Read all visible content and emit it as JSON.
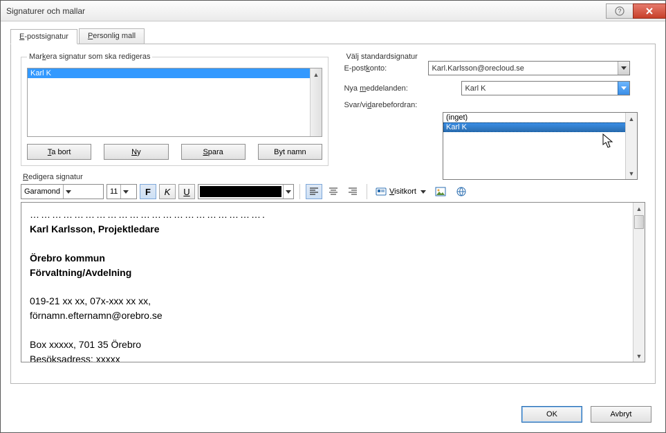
{
  "titlebar": {
    "title": "Signaturer och mallar"
  },
  "tabs": {
    "email": "E-postsignatur",
    "personal": "Personlig mall"
  },
  "select_legend_pre": "Mar",
  "select_legend_u": "k",
  "select_legend_post": "era signatur som ska redigeras",
  "signature_list": {
    "item0": "Karl K"
  },
  "buttons": {
    "delete_pre": "",
    "delete_u": "T",
    "delete_post": "a bort",
    "new_pre": "",
    "new_u": "N",
    "new_post": "y",
    "save_pre": "",
    "save_u": "S",
    "save_post": "para",
    "rename": "Byt namn"
  },
  "default_legend": "Välj standardsignatur",
  "account_label": "E-postkonto:",
  "account_value": "Karl.Karlsson@orecloud.se",
  "newmsg_label_pre": "Nya ",
  "newmsg_label_u": "m",
  "newmsg_label_post": "eddelanden:",
  "newmsg_value": "Karl K",
  "reply_label_pre": "Svar/vi",
  "reply_label_u": "d",
  "reply_label_post": "arebefordran:",
  "reply_options": {
    "none": "(inget)",
    "karl": "Karl K"
  },
  "editor_legend_pre": "",
  "editor_legend_u": "R",
  "editor_legend_post": "edigera signatur",
  "toolbar": {
    "font": "Garamond",
    "size": "11",
    "bold": "F",
    "italic": "K",
    "underline": "U",
    "visitkort_u": "V",
    "visitkort_post": "isitkort"
  },
  "editor_content": {
    "dots": "……………………………………………………….",
    "l1": "Karl Karlsson, Projektledare",
    "l2": "Örebro kommun",
    "l3": "Förvaltning/Avdelning",
    "l4": "019-21 xx xx, 07x-xxx xx xx,",
    "l5": "förnamn.efternamn@orebro.se",
    "l6": "Box xxxxx, 701 35 Örebro",
    "l7": "Besöksadress: xxxxx"
  },
  "footer": {
    "ok": "OK",
    "cancel": "Avbryt"
  }
}
